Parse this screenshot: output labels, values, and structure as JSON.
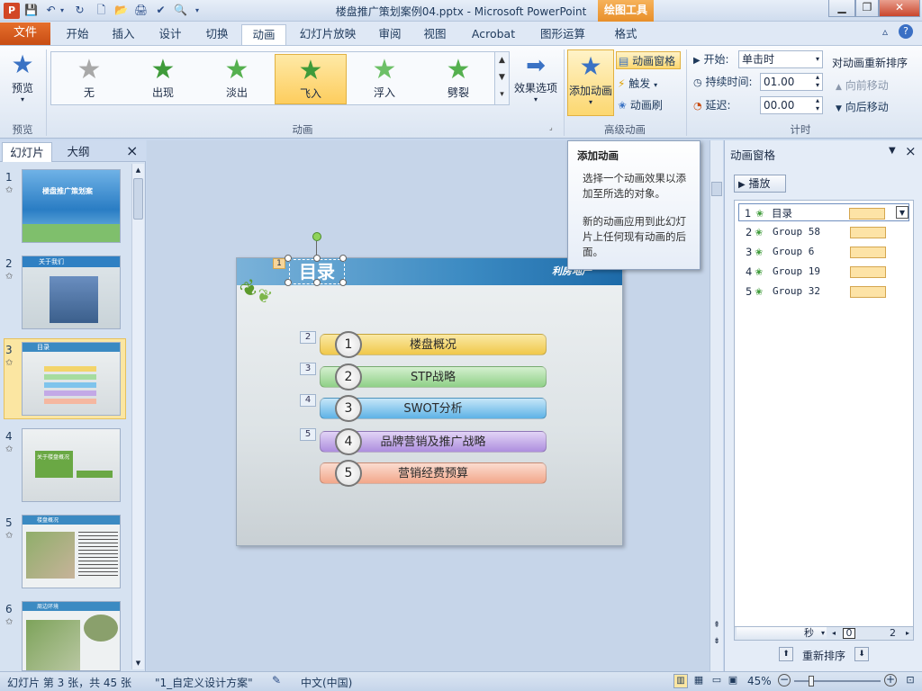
{
  "titlebar": {
    "title": "楼盘推广策划案例04.pptx - Microsoft PowerPoint",
    "tool_tab": "绘图工具",
    "quick_access": [
      "save-icon",
      "undo-icon",
      "redo-icon",
      "new-icon",
      "open-icon",
      "quick-print-icon",
      "print-preview-icon",
      "customize-icon"
    ]
  },
  "tabs": {
    "file": "文件",
    "items": [
      "开始",
      "插入",
      "设计",
      "切换",
      "动画",
      "幻灯片放映",
      "审阅",
      "视图",
      "Acrobat",
      "图形运算",
      "格式"
    ],
    "active": "动画"
  },
  "ribbon": {
    "preview": {
      "label": "预览",
      "group": "预览"
    },
    "animations": {
      "group": "动画",
      "items": [
        {
          "label": "无",
          "color": "#a8a8a8"
        },
        {
          "label": "出现",
          "color": "#3f9b3a"
        },
        {
          "label": "淡出",
          "color": "#55b04f"
        },
        {
          "label": "飞入",
          "color": "#3f9b3a"
        },
        {
          "label": "浮入",
          "color": "#6dc067"
        },
        {
          "label": "劈裂",
          "color": "#55b04f"
        }
      ],
      "selected": "飞入",
      "effect_options": "效果选项"
    },
    "advanced": {
      "group": "高级动画",
      "add_animation": "添加动画",
      "anim_pane": "动画窗格",
      "trigger": "触发",
      "painter": "动画刷"
    },
    "timing": {
      "group": "计时",
      "start_label": "开始:",
      "start_value": "单击时",
      "duration_label": "持续时间:",
      "duration_value": "01.00",
      "delay_label": "延迟:",
      "delay_value": "00.00",
      "reorder_title": "对动画重新排序",
      "move_earlier": "向前移动",
      "move_later": "向后移动"
    }
  },
  "tooltip": {
    "title": "添加动画",
    "line1": "选择一个动画效果以添加至所选的对象。",
    "line2": "新的动画应用到此幻灯片上任何现有动画的后面。"
  },
  "left_pane": {
    "tab_slides": "幻灯片",
    "tab_outline": "大纲",
    "close": "×",
    "thumbs": [
      {
        "num": "1",
        "title": "楼盘推广策划案"
      },
      {
        "num": "2",
        "title": "关于我们"
      },
      {
        "num": "3",
        "title": "目录"
      },
      {
        "num": "4",
        "title": "关于楼盘概况"
      },
      {
        "num": "5",
        "title": "楼盘概况"
      },
      {
        "num": "6",
        "title": "周边环境"
      }
    ],
    "selected_index": 2
  },
  "slide": {
    "title": "目录",
    "tag": "1",
    "logo": "利房地产",
    "items": [
      {
        "num": "1",
        "text": "楼盘概况",
        "tag": "2",
        "color": "#f3d46a"
      },
      {
        "num": "2",
        "text": "STP战略",
        "tag": "3",
        "color": "#a6dca0"
      },
      {
        "num": "3",
        "text": "SWOT分析",
        "tag": "4",
        "color": "#7fc4ec"
      },
      {
        "num": "4",
        "text": "品牌营销及推广战略",
        "tag": "5",
        "color": "#c3a9e6"
      },
      {
        "num": "5",
        "text": "营销经费预算",
        "tag": "",
        "color": "#f5b7a0"
      }
    ]
  },
  "animation_pane": {
    "title": "动画窗格",
    "play": "播放",
    "rows": [
      {
        "num": "1",
        "name": "目录"
      },
      {
        "num": "2",
        "name": "Group 58"
      },
      {
        "num": "3",
        "name": "Group 6"
      },
      {
        "num": "4",
        "name": "Group 19"
      },
      {
        "num": "5",
        "name": "Group 32"
      }
    ],
    "seconds_label": "秒",
    "timeline_start": "0",
    "timeline_end": "2",
    "reorder": "重新排序"
  },
  "status": {
    "slide_info": "幻灯片 第 3 张，共 45 张",
    "theme": "\"1_自定义设计方案\"",
    "language": "中文(中国)",
    "zoom": "45%"
  }
}
